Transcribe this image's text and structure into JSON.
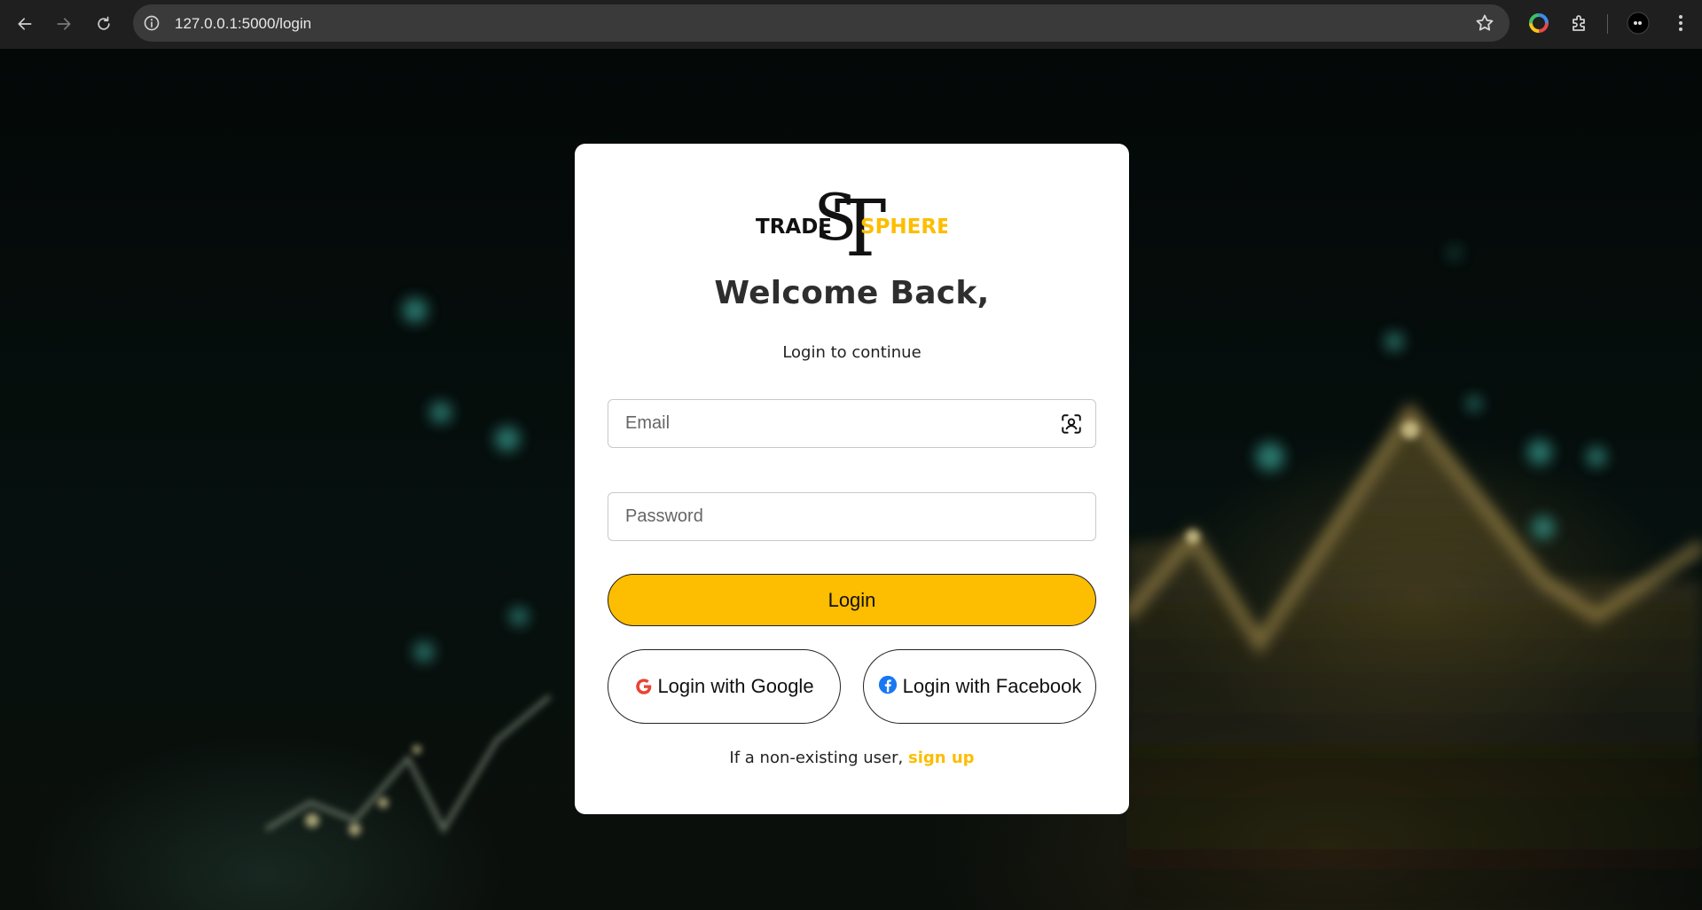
{
  "browser": {
    "url": "127.0.0.1:5000/login",
    "icons": [
      "back-icon",
      "forward-icon",
      "reload-icon",
      "site-info-icon",
      "star-icon",
      "color-picker-extension-icon",
      "extensions-icon",
      "profile-avatar",
      "menu-icon"
    ]
  },
  "logo": {
    "word_left": "TRADE",
    "word_right": "SPHERE",
    "monogram": "ST",
    "colors": {
      "dark": "#111111",
      "accent": "#fdbd00"
    }
  },
  "card": {
    "title": "Welcome Back,",
    "subtitle": "Login to continue",
    "email_placeholder": "Email",
    "password_placeholder": "Password",
    "login_label": "Login",
    "google_label": "Login with Google",
    "facebook_label": "Login with Facebook",
    "signup_prefix": "If a non-existing user,",
    "signup_link": "sign up"
  },
  "colors": {
    "accent": "#fdbd00",
    "google": "#ea4335",
    "facebook": "#1877f2"
  }
}
